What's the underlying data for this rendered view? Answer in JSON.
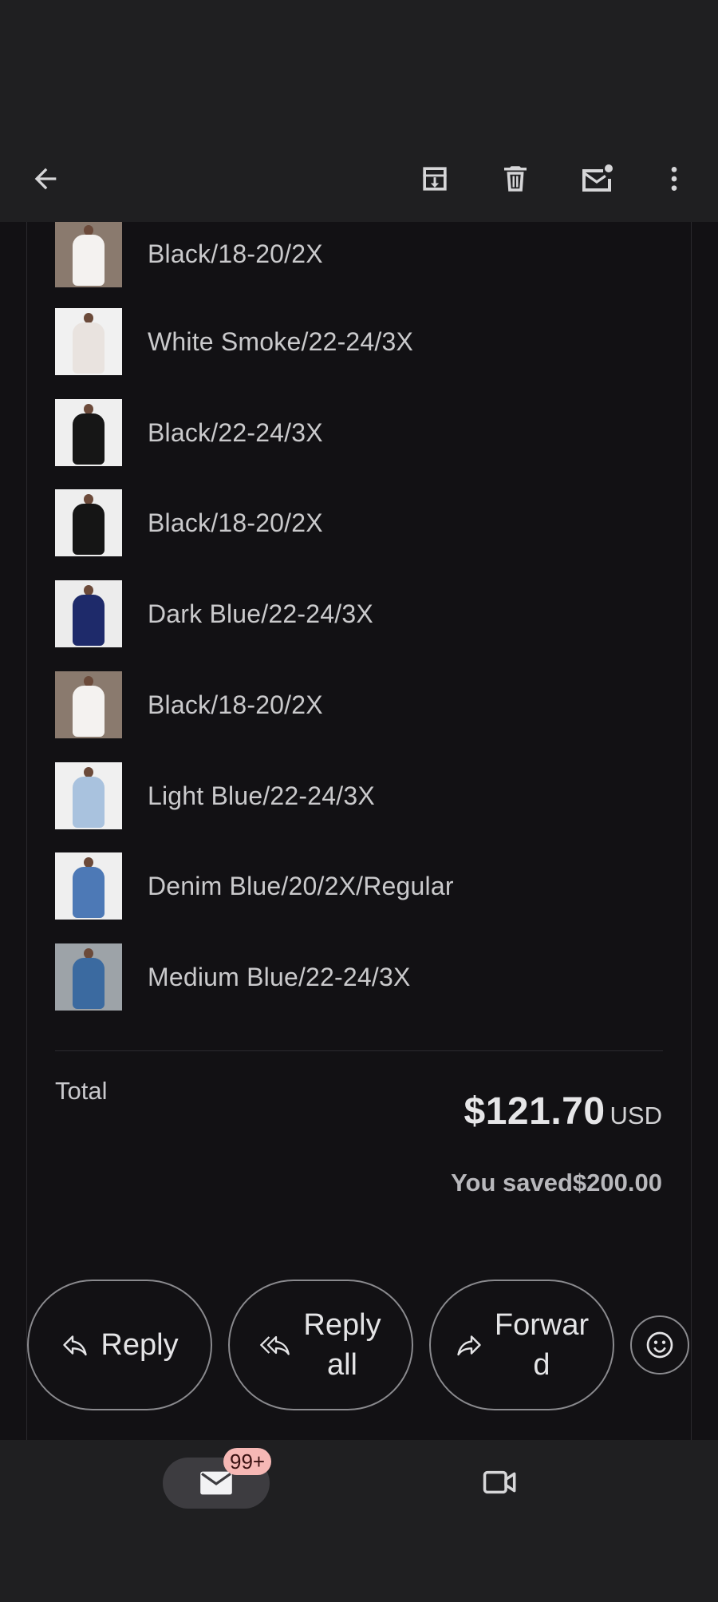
{
  "toolbar": {
    "back_icon": "arrow-left-icon",
    "archive_icon": "archive-icon",
    "delete_icon": "trash-icon",
    "mark_unread_icon": "mail-unread-icon",
    "more_icon": "more-vertical-icon"
  },
  "order_items": [
    {
      "label": "Black/18-20/2X",
      "thumb_bg": "#8a7a6e",
      "garment": "#f4f2f0"
    },
    {
      "label": "White Smoke/22-24/3X",
      "thumb_bg": "#f1f1f1",
      "garment": "#e9e3df"
    },
    {
      "label": "Black/22-24/3X",
      "thumb_bg": "#efefef",
      "garment": "#161616"
    },
    {
      "label": "Black/18-20/2X",
      "thumb_bg": "#eeeeee",
      "garment": "#151515"
    },
    {
      "label": "Dark Blue/22-24/3X",
      "thumb_bg": "#ececec",
      "garment": "#1e2a6a"
    },
    {
      "label": "Black/18-20/2X",
      "thumb_bg": "#8a7a6e",
      "garment": "#f4f2f0"
    },
    {
      "label": "Light Blue/22-24/3X",
      "thumb_bg": "#f0f0f0",
      "garment": "#a9c2de"
    },
    {
      "label": "Denim Blue/20/2X/Regular",
      "thumb_bg": "#efefef",
      "garment": "#4d79b6"
    },
    {
      "label": "Medium Blue/22-24/3X",
      "thumb_bg": "#9da3a8",
      "garment": "#3b6aa0"
    }
  ],
  "summary": {
    "total_label": "Total",
    "total_amount": "$121.70",
    "currency": "USD",
    "saved_text": "You saved$200.00"
  },
  "actions": {
    "reply": "Reply",
    "reply_all_line1": "Reply",
    "reply_all_line2": "all",
    "forward_line1": "Forwar",
    "forward_line2": "d"
  },
  "nav": {
    "mail_badge": "99+",
    "mail_icon": "mail-icon",
    "meet_icon": "video-camera-icon"
  },
  "colors": {
    "background": "#1f1f21",
    "content_background": "#121114",
    "badge": "#f6b8b5"
  }
}
